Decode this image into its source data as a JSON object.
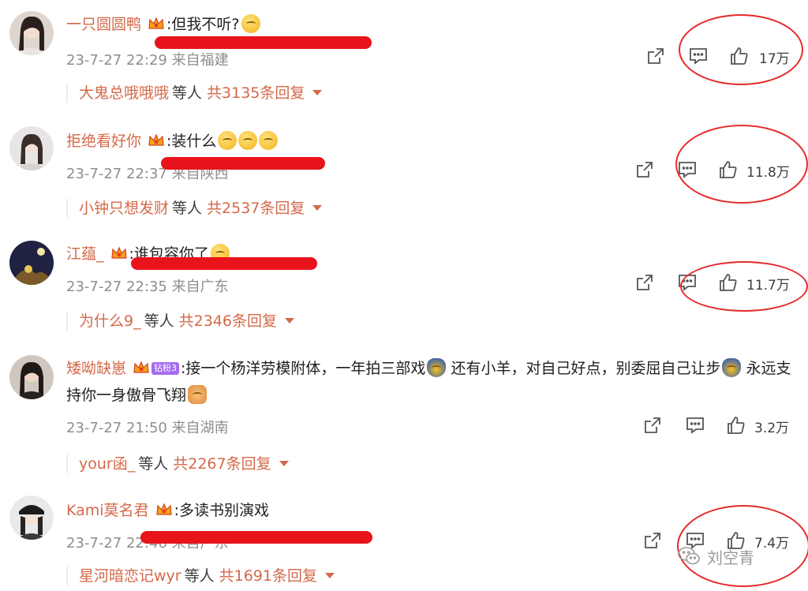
{
  "comments": [
    {
      "username": "一只圆圆鸭",
      "text": ":但我不听?",
      "timestamp": "23-7-27 22:29",
      "location": "来自福建",
      "likes": "17万",
      "reply_name": "大鬼总哦哦哦",
      "reply_etc": "等人",
      "reply_count": "共3135条回复"
    },
    {
      "username": "拒绝看好你",
      "text": ":装什么",
      "timestamp": "23-7-27 22:37",
      "location": "来自陕西",
      "likes": "11.8万",
      "reply_name": "小钟只想发财",
      "reply_etc": "等人",
      "reply_count": "共2537条回复"
    },
    {
      "username": "江蕴_",
      "text": ":谁包容你了",
      "timestamp": "23-7-27 22:35",
      "location": "来自广东",
      "likes": "11.7万",
      "reply_name": "为什么9_",
      "reply_etc": "等人",
      "reply_count": "共2346条回复"
    },
    {
      "username": "矮呦缺崽",
      "fan_badge": "钻粉3",
      "text": ":接一个杨洋劳模附体，一年拍三部戏",
      "text_cont": "还有小羊，对自己好点，别委屈自己让步",
      "text_cont2": "永远支持你一身傲骨飞翔",
      "timestamp": "23-7-27 21:50",
      "location": "来自湖南",
      "likes": "3.2万",
      "reply_name": "your函_",
      "reply_etc": "等人",
      "reply_count": "共2267条回复"
    },
    {
      "username": "Kami莫名君",
      "text": ":多读书别演戏",
      "timestamp": "23-7-27 22:46",
      "location": "来自广东",
      "likes": "7.4万",
      "reply_name": "星河暗恋记wyr",
      "reply_etc": "等人",
      "reply_count": "共1691条回复"
    }
  ],
  "watermark": "刘空青",
  "colors": {
    "username": "#d4694a",
    "meta": "#8e8e8e",
    "redaction": "#e8131b",
    "annotation_circle": "#e52a2a"
  },
  "icons": [
    "share-icon",
    "comment-icon",
    "like-icon",
    "crown-badge-icon",
    "wechat-icon"
  ]
}
